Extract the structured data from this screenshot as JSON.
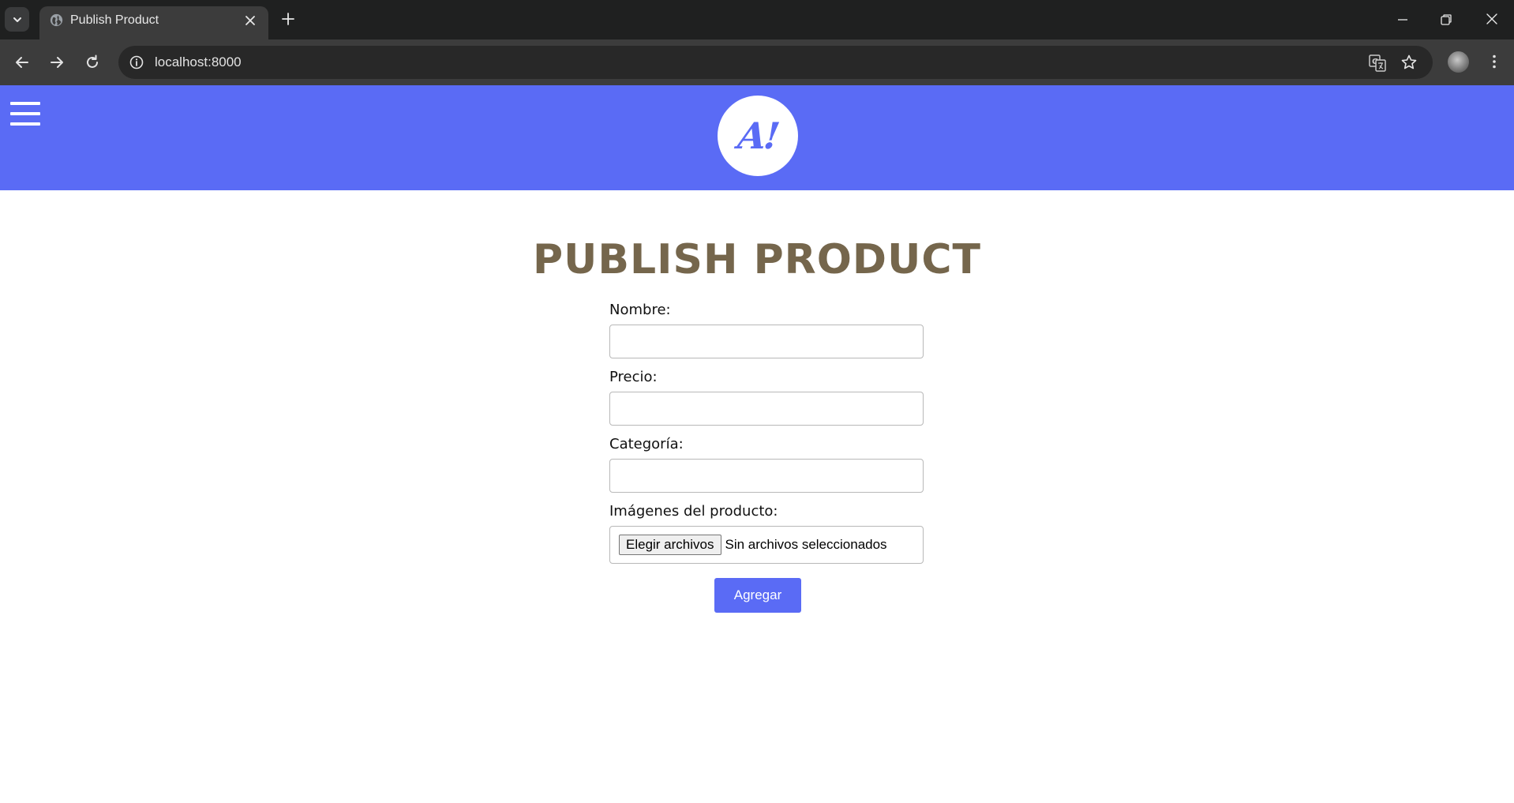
{
  "browser": {
    "tab_title": "Publish Product",
    "url": "localhost:8000"
  },
  "colors": {
    "accent": "#5a6bf5",
    "title": "#75664c",
    "chrome_dark": "#1f2020",
    "chrome_toolbar": "#3c3c3c"
  },
  "header": {
    "logo_text": "A!"
  },
  "page": {
    "title": "PUBLISH PRODUCT"
  },
  "form": {
    "name_label": "Nombre:",
    "name_value": "",
    "price_label": "Precio:",
    "price_value": "",
    "category_label": "Categoría:",
    "category_value": "",
    "images_label": "Imágenes del producto:",
    "file_button_label": "Elegir archivos",
    "file_status": "Sin archivos seleccionados",
    "submit_label": "Agregar"
  }
}
